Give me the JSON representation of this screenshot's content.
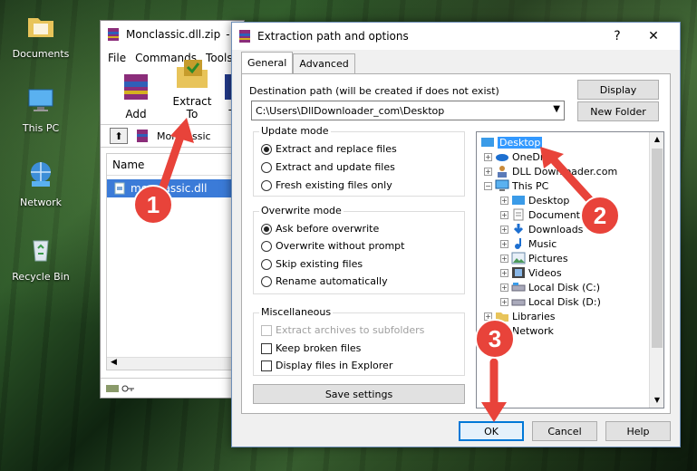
{
  "desktop": {
    "icons": [
      {
        "label": "Documents"
      },
      {
        "label": "This PC"
      },
      {
        "label": "Network"
      },
      {
        "label": "Recycle Bin"
      }
    ]
  },
  "winrar": {
    "title": "Monclassic.dll.zip",
    "title_suffix": "-",
    "menu": [
      "File",
      "Commands",
      "Tools"
    ],
    "tools": [
      {
        "label": "Add"
      },
      {
        "label": "Extract To"
      },
      {
        "label": "T"
      }
    ],
    "path_text": "Monclassic",
    "column_name": "Name",
    "file_name": "monclassic.dll"
  },
  "dialog": {
    "title": "Extraction path and options",
    "help_glyph": "?",
    "close_glyph": "✕",
    "tabs": [
      {
        "label": "General"
      },
      {
        "label": "Advanced"
      }
    ],
    "destination_label": "Destination path (will be created if does not exist)",
    "destination_value": "C:\\Users\\DllDownloader_com\\Desktop",
    "display_button": "Display",
    "new_folder_button": "New Folder",
    "update_mode": {
      "title": "Update mode",
      "options": [
        "Extract and replace files",
        "Extract and update files",
        "Fresh existing files only"
      ],
      "selected": 0
    },
    "overwrite_mode": {
      "title": "Overwrite mode",
      "options": [
        "Ask before overwrite",
        "Overwrite without prompt",
        "Skip existing files",
        "Rename automatically"
      ],
      "selected": 0
    },
    "miscellaneous": {
      "title": "Miscellaneous",
      "options": [
        "Extract archives to subfolders",
        "Keep broken files",
        "Display files in Explorer"
      ]
    },
    "save_settings_button": "Save settings",
    "tree": [
      {
        "label": "Desktop"
      },
      {
        "label": "OneDrive"
      },
      {
        "label": "DLL Downloader.com"
      },
      {
        "label": "This PC"
      },
      {
        "label": "Desktop"
      },
      {
        "label": "Documents"
      },
      {
        "label": "Downloads"
      },
      {
        "label": "Music"
      },
      {
        "label": "Pictures"
      },
      {
        "label": "Videos"
      },
      {
        "label": "Local Disk (C:)"
      },
      {
        "label": "Local Disk (D:)"
      },
      {
        "label": "Libraries"
      },
      {
        "label": "Network"
      }
    ],
    "ok_button": "OK",
    "cancel_button": "Cancel",
    "help_button": "Help"
  },
  "annotations": [
    "1",
    "2",
    "3"
  ],
  "colors": {
    "accent": "#0078d7",
    "selection": "#3399ff",
    "badge": "#e8433a"
  }
}
